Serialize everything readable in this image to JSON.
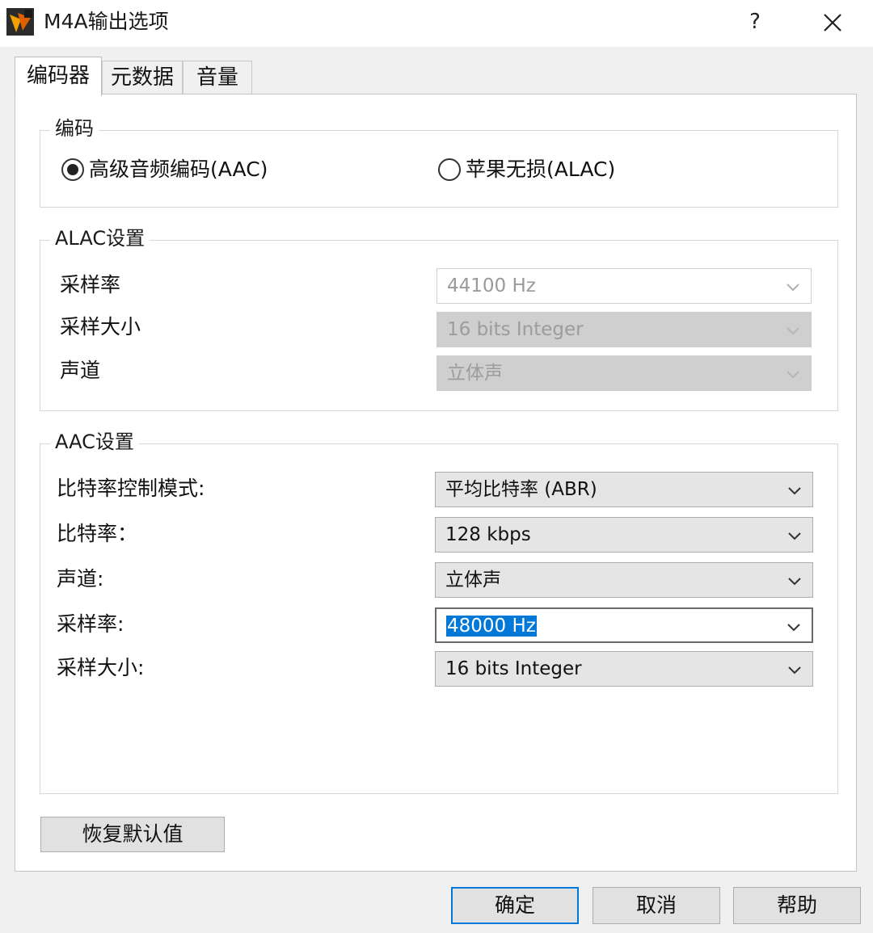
{
  "window": {
    "title": "M4A输出选项",
    "help_label": "?",
    "close_icon": "close-icon",
    "app_icon": "app-logo-icon"
  },
  "tabs": [
    {
      "label": "编码器",
      "active": true
    },
    {
      "label": "元数据",
      "active": false
    },
    {
      "label": "音量",
      "active": false
    }
  ],
  "encoding": {
    "legend": "编码",
    "options": [
      {
        "label": "高级音频编码(AAC)",
        "checked": true
      },
      {
        "label": "苹果无损(ALAC)",
        "checked": false
      }
    ]
  },
  "alac": {
    "legend": "ALAC设置",
    "fields": [
      {
        "label": "采样率",
        "value": "44100 Hz"
      },
      {
        "label": "采样大小",
        "value": "16 bits Integer"
      },
      {
        "label": "声道",
        "value": "立体声"
      }
    ]
  },
  "aac": {
    "legend": "AAC设置",
    "fields": [
      {
        "label": "比特率控制模式:",
        "value": "平均比特率 (ABR)"
      },
      {
        "label": "比特率：",
        "value": "128 kbps"
      },
      {
        "label": "声道:",
        "value": "立体声"
      },
      {
        "label": "采样率:",
        "value": "48000 Hz"
      },
      {
        "label": "采样大小:",
        "value": "16 bits Integer"
      }
    ]
  },
  "buttons": {
    "restore_defaults": "恢复默认值",
    "ok": "确定",
    "cancel": "取消",
    "help": "帮助"
  },
  "colors": {
    "accent": "#0078d7",
    "background": "#f0f0f0"
  }
}
